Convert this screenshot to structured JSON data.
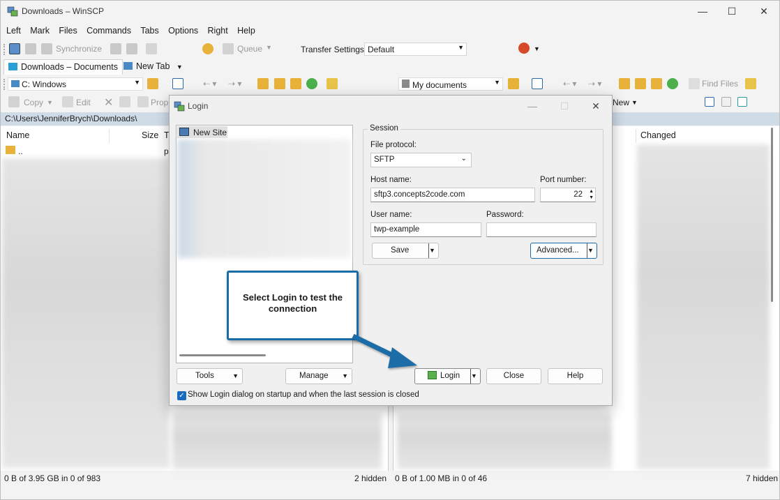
{
  "window": {
    "title": "Downloads – WinSCP",
    "minimize": "—",
    "maximize": "☐",
    "close": "✕"
  },
  "menu": [
    "Left",
    "Mark",
    "Files",
    "Commands",
    "Tabs",
    "Options",
    "Right",
    "Help"
  ],
  "toolbar": {
    "synchronize": "Synchronize",
    "queue": "Queue",
    "transfer_settings_label": "Transfer Settings",
    "transfer_settings_value": "Default"
  },
  "tabs": [
    {
      "label": "Downloads – Documents"
    },
    {
      "label": "New Tab"
    }
  ],
  "left_panel": {
    "drive": "C: Windows",
    "copy": "Copy",
    "edit": "Edit",
    "properties": "Prop",
    "path": "C:\\Users\\JenniferBrych\\Downloads\\",
    "col_name": "Name",
    "col_size": "Size",
    "col_type": "T",
    "parent_row": "..",
    "parent_type": "p",
    "status": "0 B of 3.95 GB in 0 of 983",
    "hidden": "2 hidden"
  },
  "right_panel": {
    "location": "My documents",
    "find_files": "Find Files",
    "new": "New",
    "col_changed": "Changed",
    "status": "0 B of 1.00 MB in 0 of 46",
    "hidden": "7 hidden"
  },
  "login_dialog": {
    "title": "Login",
    "tree_root": "New Site",
    "session_group": "Session",
    "file_protocol_label": "File protocol:",
    "file_protocol_value": "SFTP",
    "host_label": "Host name:",
    "host_value": "sftp3.concepts2code.com",
    "port_label": "Port number:",
    "port_value": "22",
    "user_label": "User name:",
    "user_value": "twp-example",
    "password_label": "Password:",
    "password_value": "",
    "save": "Save",
    "advanced": "Advanced...",
    "tools": "Tools",
    "manage": "Manage",
    "login": "Login",
    "close": "Close",
    "help": "Help",
    "show_login_checkbox": "Show Login dialog on startup and when the last session is closed"
  },
  "callout": {
    "text": "Select Login to test the connection"
  },
  "colors": {
    "accent": "#1a6ca8",
    "path_bar": "#cfdbe7",
    "checkbox": "#1a6bc0"
  }
}
